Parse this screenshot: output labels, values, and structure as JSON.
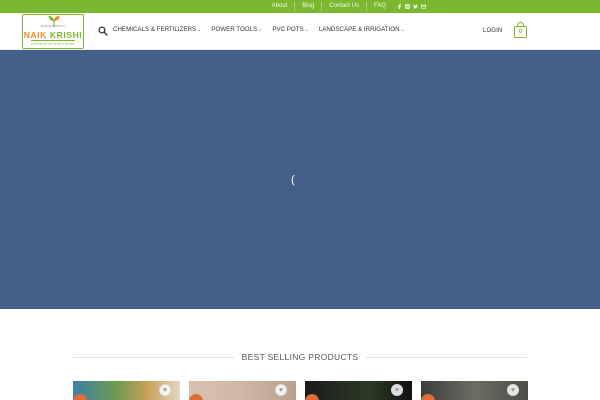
{
  "topbar": {
    "links": [
      "About",
      "Blog",
      "Contact Us",
      "FAQ"
    ],
    "social_icons": [
      "facebook-icon",
      "instagram-icon",
      "twitter-icon",
      "email-icon"
    ]
  },
  "header": {
    "logo": {
      "tagline_top": "MAHARASHTRA'S",
      "brand_first": "NAIK",
      "brand_second": "KRISHI",
      "tagline": "GARDENING SIMPLIFIED"
    },
    "nav": [
      {
        "label": "CHEMICALS & FERTILIZERS"
      },
      {
        "label": "POWER TOOLS"
      },
      {
        "label": "PVC POTS"
      },
      {
        "label": "LANDSCAPE & IRRIGATION"
      }
    ],
    "login_label": "LOGIN",
    "cart_count": "0"
  },
  "hero": {
    "background": "#435f8a",
    "loader_glyph": "("
  },
  "best_selling": {
    "title": "BEST SELLING PRODUCTS",
    "products": [
      {
        "image": "p1"
      },
      {
        "image": "p2"
      },
      {
        "image": "p3"
      },
      {
        "image": "p4"
      }
    ]
  },
  "colors": {
    "brand_green": "#7cb82f",
    "brand_orange": "#f08a1d"
  }
}
